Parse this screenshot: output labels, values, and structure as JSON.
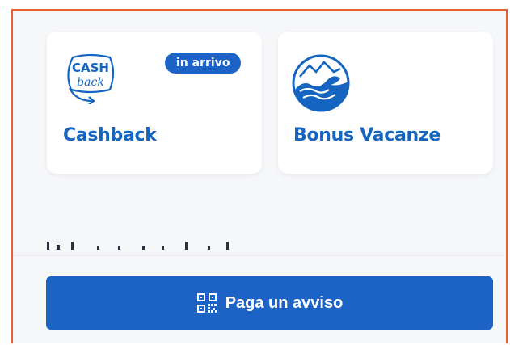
{
  "cards": [
    {
      "label": "Cashback",
      "badge": "in arrivo",
      "icon": "cashback-logo-icon",
      "logo_text": [
        "CASH",
        "back"
      ]
    },
    {
      "label": "Bonus Vacanze",
      "icon": "bonus-vacanze-wave-icon"
    }
  ],
  "footer": {
    "button_label": "Paga un avviso",
    "button_icon": "qr-code-icon"
  },
  "colors": {
    "accent": "#1d63c6",
    "label": "#1565c0",
    "frame_border": "#e8622f",
    "background": "#f6f7f9"
  }
}
